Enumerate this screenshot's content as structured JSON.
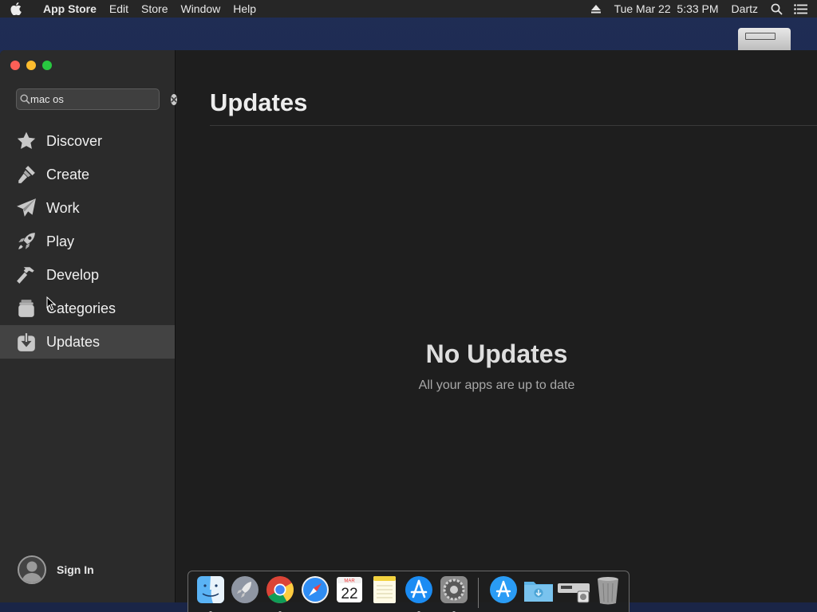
{
  "menubar": {
    "apple_icon": "apple-icon",
    "app_name": "App Store",
    "menus": [
      "Edit",
      "Store",
      "Window",
      "Help"
    ],
    "eject_icon": "eject-icon",
    "datetime": "Tue Mar 22  5:33 PM",
    "user": "Dartz",
    "spotlight_icon": "spotlight-search-icon",
    "notification_icon": "notification-center-icon"
  },
  "sidebar": {
    "search": {
      "value": "mac os",
      "placeholder": "Search"
    },
    "items": [
      {
        "label": "Discover",
        "icon": "star-icon"
      },
      {
        "label": "Create",
        "icon": "paintbrush-icon"
      },
      {
        "label": "Work",
        "icon": "paper-plane-icon"
      },
      {
        "label": "Play",
        "icon": "rocket-icon"
      },
      {
        "label": "Develop",
        "icon": "hammer-icon"
      },
      {
        "label": "Categories",
        "icon": "stack-icon"
      },
      {
        "label": "Updates",
        "icon": "download-icon"
      }
    ],
    "active": "Updates",
    "sign_in_label": "Sign In"
  },
  "main": {
    "title": "Updates",
    "empty_title": "No Updates",
    "empty_subtitle": "All your apps are up to date"
  },
  "dock": {
    "items": [
      {
        "name": "Finder",
        "running": true
      },
      {
        "name": "Launchpad",
        "running": false
      },
      {
        "name": "Chrome",
        "running": true
      },
      {
        "name": "Safari",
        "running": false
      },
      {
        "name": "Calendar",
        "running": false,
        "month": "MAR",
        "day": "22"
      },
      {
        "name": "Notes",
        "running": false
      },
      {
        "name": "App Store",
        "running": true
      },
      {
        "name": "System Preferences",
        "running": true
      },
      {
        "name": "Applications",
        "running": false
      },
      {
        "name": "Downloads",
        "running": false
      },
      {
        "name": "Disk Image",
        "running": false
      },
      {
        "name": "Trash",
        "running": false
      }
    ]
  },
  "colors": {
    "sidebar_bg": "#2b2b2b",
    "main_bg": "#1e1e1e",
    "active_row": "#434343",
    "close": "#fc5f57",
    "minimize": "#fdbc2e",
    "maximize": "#28c840"
  }
}
